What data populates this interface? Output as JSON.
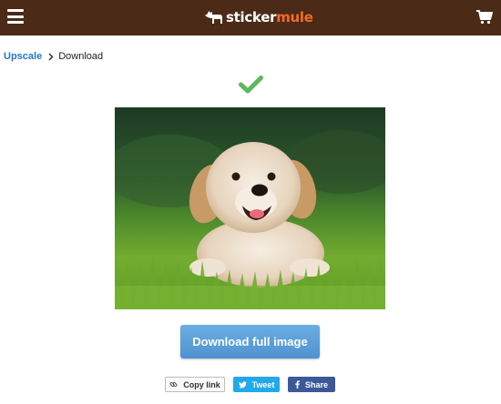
{
  "header": {
    "logo_part1": "sticker",
    "logo_part2": "mule",
    "menu_icon": "hamburger-menu-icon",
    "cart_icon": "shopping-cart-icon",
    "bg_color": "#4b2a17",
    "accent_color": "#f26c27"
  },
  "breadcrumb": {
    "parent": "Upscale",
    "separator_icon": "chevron-right-icon",
    "current": "Download"
  },
  "status": {
    "icon": "checkmark-icon",
    "color": "#5cb85c"
  },
  "download_button": {
    "label": "Download full image",
    "color": "#5a9fd8"
  },
  "share": {
    "copy_label": "Copy link",
    "copy_icon": "link-icon",
    "tweet_label": "Tweet",
    "tweet_icon": "twitter-icon",
    "tweet_color": "#21a9ea",
    "facebook_label": "Share",
    "facebook_icon": "facebook-icon",
    "facebook_color": "#3b5998"
  }
}
